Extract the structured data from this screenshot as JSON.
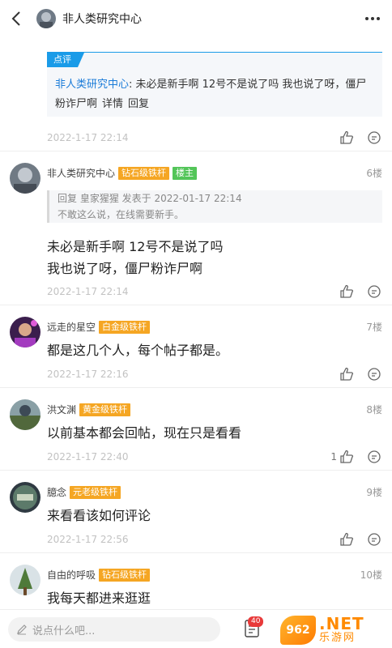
{
  "header": {
    "title": "非人类研究中心"
  },
  "review": {
    "tag": "点评",
    "author": "非人类研究中心",
    "text": ": 未必是新手啊 12号不是说了吗 我也说了呀，僵尸粉诈尸啊",
    "detail_link": "详情",
    "reply_link": "回复",
    "time": "2022-1-17 22:14"
  },
  "posts": [
    {
      "username": "非人类研究中心",
      "badges": [
        "钻石级铁杆",
        "楼主"
      ],
      "floor": "6楼",
      "quote_line1": "回复 皇家猩猩 发表于 2022-01-17 22:14",
      "quote_line2": "不敢这么说，在线需要新手。",
      "body_line1": "未必是新手啊   12号不是说了吗",
      "body_line2": "我也说了呀，僵尸粉诈尸啊",
      "time": "2022-1-17 22:14"
    },
    {
      "username": "远走的星空",
      "badges": [
        "白金级铁杆"
      ],
      "floor": "7楼",
      "body": "都是这几个人，每个帖子都是。",
      "time": "2022-1-17 22:16"
    },
    {
      "username": "洪文渊",
      "badges": [
        "黄金级铁杆"
      ],
      "floor": "8楼",
      "body": "以前基本都会回帖，现在只是看看",
      "time": "2022-1-17 22:40",
      "likes": "1"
    },
    {
      "username": "臆念",
      "badges": [
        "元老级铁杆"
      ],
      "floor": "9楼",
      "body": "来看看该如何评论",
      "time": "2022-1-17 22:56"
    },
    {
      "username": "自由的呼吸",
      "badges": [
        "钻石级铁杆"
      ],
      "floor": "10楼",
      "body": "我每天都进来逛逛"
    }
  ],
  "footer": {
    "comment_placeholder": "说点什么吧...",
    "reply_count": "40"
  },
  "watermark": {
    "logo": "962",
    "net": ".NET",
    "sub": "乐游网"
  },
  "colors": {
    "accent_blue": "#1a9be8",
    "badge_orange": "#f5a623",
    "badge_green": "#53c559",
    "time_gray": "#c2c2c2"
  }
}
